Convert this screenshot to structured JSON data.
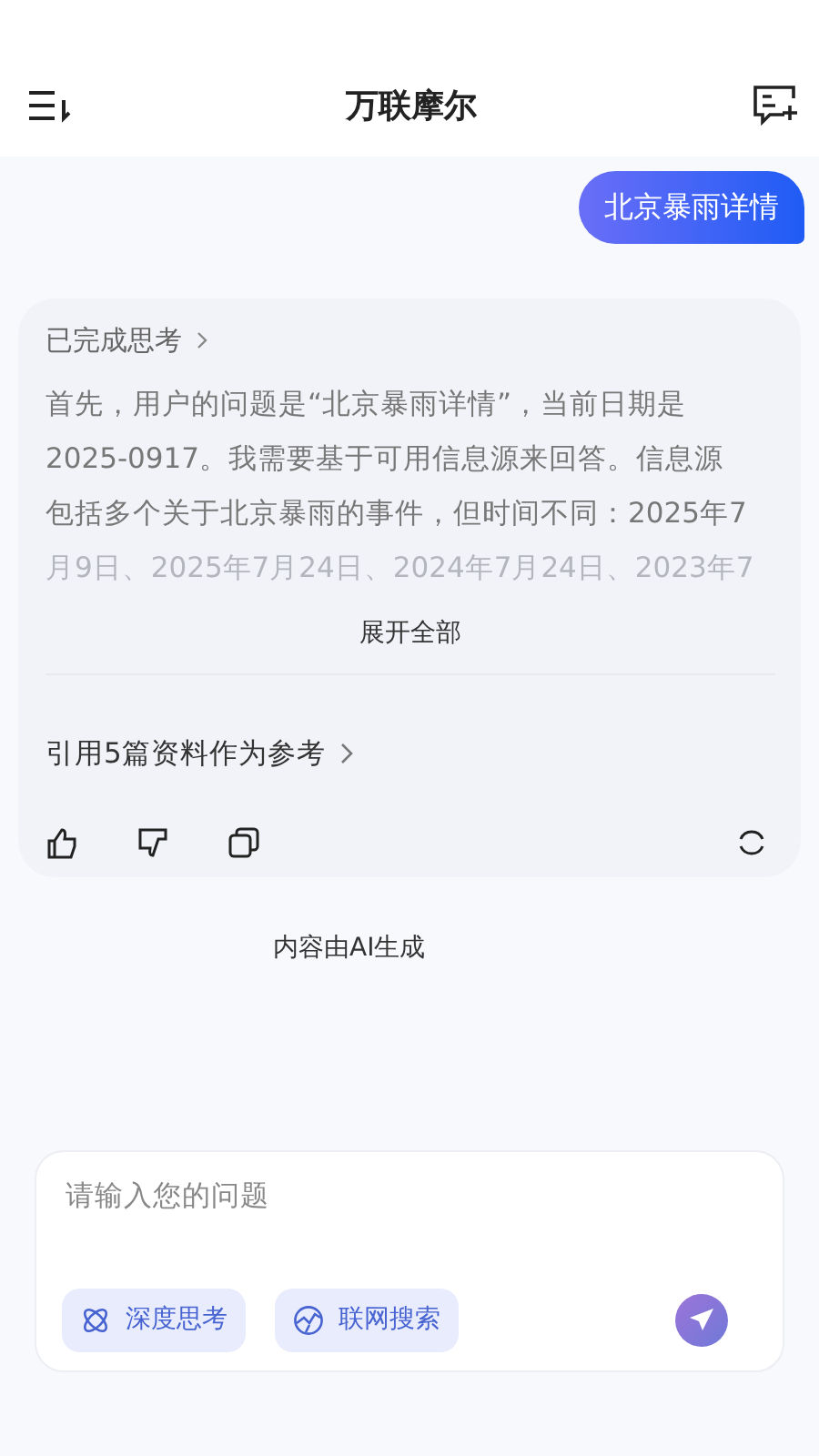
{
  "header": {
    "title": "万联摩尔"
  },
  "messages": [
    {
      "kind": "user",
      "text": "北京暴雨详情"
    }
  ],
  "answer": {
    "thinking_label": "已完成思考",
    "thinking_lines": [
      "首先，用户的问题是“北京暴雨详情”，当前日期是",
      "2025-0917。我需要基于可用信息源来回答。信息源",
      "包括多个关于北京暴雨的事件，但时间不同：2025年7",
      "月9日、2025年7月24日、2024年7月24日、2023年7"
    ],
    "expand": "展开全部",
    "references": "引用5篇资料作为参考"
  },
  "disclaimer": "内容由AI生成",
  "composer": {
    "placeholder": "请输入您的问题",
    "chips": [
      {
        "kind": "think",
        "label": "深度思考"
      },
      {
        "kind": "web",
        "label": "联网搜索"
      }
    ]
  }
}
